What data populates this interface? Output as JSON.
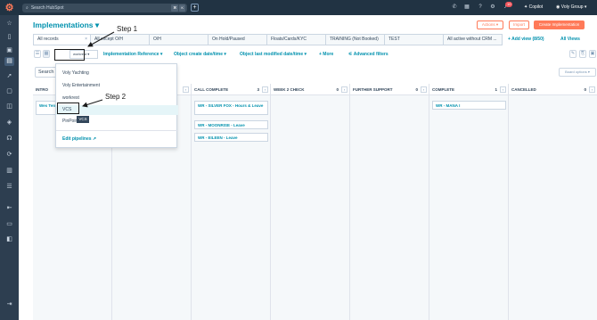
{
  "topbar": {
    "search_placeholder": "Search HubSpot",
    "shortcut_keys": [
      "⌘",
      "K"
    ],
    "notification_count": "10",
    "copilot_label": "Copilot",
    "account_label": "Voly Group"
  },
  "page": {
    "title": "Implementations",
    "actions_label": "Actions",
    "import_label": "Import",
    "create_label": "Create Implementation"
  },
  "tabs": {
    "items": [
      {
        "label": "All records"
      },
      {
        "label": "All except O/H"
      },
      {
        "label": "O/H"
      },
      {
        "label": "On Hold/Paused"
      },
      {
        "label": "Floats/Cards/KYC"
      },
      {
        "label": "TRAINING (Not Booked)"
      },
      {
        "label": "TEST"
      },
      {
        "label": "All active without CRM ..."
      }
    ],
    "add_view_label": "Add view (8/50)",
    "all_views_label": "All Views"
  },
  "filters": {
    "pipeline_value": "workrest",
    "implementation_reference": "Implementation Reference",
    "object_create_date": "Object create date/time",
    "object_last_modified": "Object last modified date/time",
    "more": "+ More",
    "advanced_filters": "Advanced filters"
  },
  "toolbar": {
    "search_text": "Search",
    "board_options": "Board options"
  },
  "board": {
    "columns": [
      {
        "name": "INTRO",
        "count": "",
        "cards": [
          "Wes Ten... (clone)"
        ]
      },
      {
        "name": "",
        "count": "",
        "cards": []
      },
      {
        "name": "CALL COMPLETE",
        "count": "3",
        "cards": [
          "WR - SILVER FOX - Hours & Leave",
          "WR - MOONRISE - Leave",
          "WR - EILEEN - Leave"
        ]
      },
      {
        "name": "WEEK 2 CHECK",
        "count": "0",
        "cards": []
      },
      {
        "name": "FURTHER SUPPORT",
        "count": "0",
        "cards": []
      },
      {
        "name": "COMPLETE",
        "count": "1",
        "cards": [
          "WR - MANA I"
        ]
      },
      {
        "name": "CANCELLED",
        "count": "0",
        "cards": []
      }
    ]
  },
  "dropdown": {
    "options": [
      "Voly Yachting",
      "Voly Entertainment",
      "workrest",
      "VCS",
      "PinPoint Pay"
    ],
    "edit_label": "Edit pipelines",
    "tooltip": "VCS"
  },
  "annotations": {
    "step1": "Step 1",
    "step2": "Step 2"
  }
}
